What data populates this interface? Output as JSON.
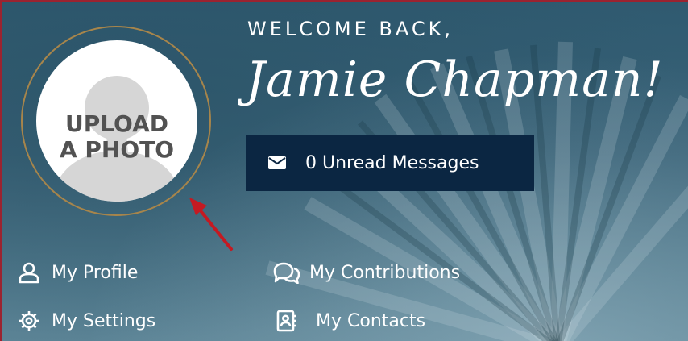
{
  "avatar": {
    "upload_line1": "UPLOAD",
    "upload_line2": "A PHOTO"
  },
  "greeting": {
    "welcome": "WELCOME BACK,",
    "name": "Jamie Chapman!"
  },
  "messages": {
    "label": "0 Unread Messages",
    "icon": "envelope-icon"
  },
  "nav": {
    "profile": {
      "label": "My Profile",
      "icon": "user-icon"
    },
    "settings": {
      "label": "My Settings",
      "icon": "gear-icon"
    },
    "contributions": {
      "label": "My Contributions",
      "icon": "chat-bubbles-icon"
    },
    "contacts": {
      "label": "My Contacts",
      "icon": "address-book-icon"
    }
  },
  "colors": {
    "background": "#2c5266",
    "button": "#0b2642",
    "ring": "#a7854b",
    "arrow": "#c41a22",
    "border": "#9b2330"
  }
}
